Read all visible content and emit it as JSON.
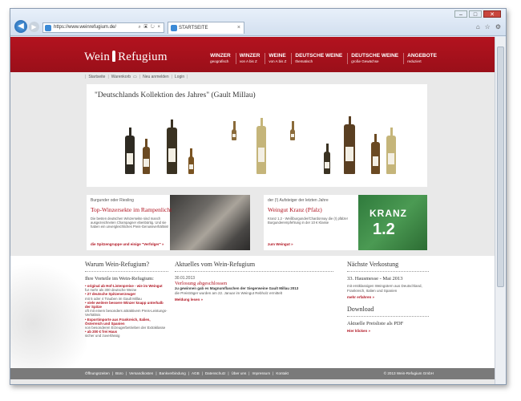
{
  "browser": {
    "url": "https://www.weinrefugium.de/",
    "tab_title": "STARTSEITE",
    "min": "–",
    "max": "□",
    "close": "✕"
  },
  "site": {
    "logo_text_left": "Wein",
    "logo_text_right": "Refugium",
    "menu": [
      {
        "title": "WINZER",
        "sub": "geografisch"
      },
      {
        "title": "WINZER",
        "sub": "von A bis Z"
      },
      {
        "title": "WEINE",
        "sub": "von A bis Z"
      },
      {
        "title": "DEUTSCHE WEINE",
        "sub": "thematisch"
      },
      {
        "title": "DEUTSCHE WEINE",
        "sub": "große Gewächse"
      },
      {
        "title": "ANGEBOTE",
        "sub": "reduziert"
      }
    ],
    "subnav": [
      "Startseite",
      "Warenkorb",
      "Neu anmelden",
      "Login"
    ]
  },
  "featured": {
    "title": "\"Deutschlands Kollektion des Jahres\" (Gault Millau)"
  },
  "promo_left": {
    "kicker": "Burgunder oder Riesling",
    "title": "Top-Winzersekte im Rampenlicht",
    "text": "Die besten deutschen Winzersekte sind manch ausgezeichneten Champagner ebenbürtig. Und sie haben ein unvergleichliches Preis-Genussverhältnis!",
    "link": "die Spitzengruppe und einige \"Verfolger\" »"
  },
  "promo_right": {
    "kicker": "der (!) Aufsteiger der letzten Jahre",
    "title": "Weingut Kranz (Pfalz)",
    "text": "Kranz 1.2 - Weißburgunder/Chardonnay die (!) pfälzer Burgunderempfehlung in der 10 € Klasse",
    "link": "zum Weingut »",
    "image_word": "KRANZ",
    "image_num": "1.2"
  },
  "why": {
    "heading": "Warum Wein-Refugium?",
    "sub": "Ihre Vorteile im Wein-Refugium:",
    "items": [
      {
        "red": "• original ab Hof-Listenpreise - wie im Weingut",
        "grey": "fur mehr als 300 deutsche Weine"
      },
      {
        "red": "• 27 deutsche Spitzenerzeuger",
        "grey": "mit 5 oder 4 Trauben im Gault Millau"
      },
      {
        "red": "• viele weitere bessere Winzer knapp unterhalb der Spitze",
        "grey": "oft mit einem besonders attraktivem Preis-Leistungs-Verhältnis"
      },
      {
        "red": "• Exportimporte aus Frankreich, Italien, Österreich und Spanien",
        "grey": "von besonderen Erzeugerbetrieben der Extraklasse"
      },
      {
        "red": "• ab 200 € frei Haus",
        "grey": "sicher und zuverlässig"
      }
    ]
  },
  "news": {
    "heading": "Aktuelles vom Wein-Refugium",
    "date": "30.01.2013",
    "title": "Verlosung abgeschlossen",
    "body_bold": "zu gewinnen gab es Magnumflaschen der Siegerweine Gault Millau 2013",
    "body": "die Preisträger wurden am 22. Januar im Weingut Rebholz ermittelt",
    "more": "Meldung lesen »"
  },
  "tasting": {
    "heading": "Nächste Verkostung",
    "sub": "33. Hausmesse - Mai 2013",
    "text": "mit erstklassigen Weingütern aus Deutschland, Frankreich, Italien und Spanien",
    "more": "mehr erfahren »"
  },
  "download": {
    "heading": "Download",
    "sub": "Aktuelle Preisliste als PDF",
    "more": "Hier klicken »"
  },
  "footer": {
    "links": [
      "Öffnungszeiten",
      "Büro",
      "Versandkosten",
      "Bankverbindung",
      "AGB",
      "Datenschutz",
      "Über uns",
      "Impressum",
      "Kontakt"
    ],
    "copyright": "© 2013 Wein-Refugium GmbH"
  },
  "colors": {
    "brand_red": "#b3131f",
    "footer_grey": "#7a7a7a"
  }
}
